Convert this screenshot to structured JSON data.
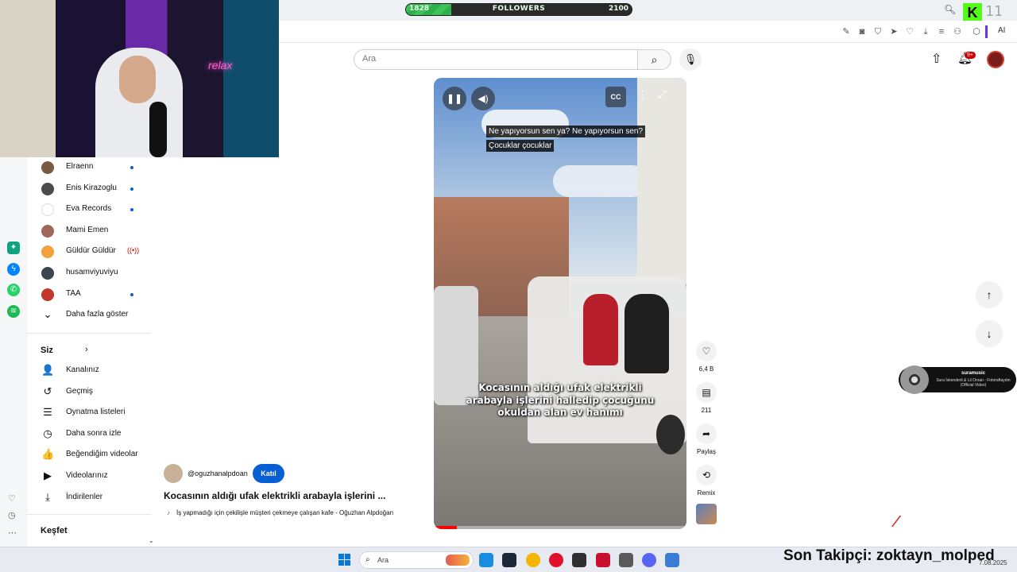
{
  "browser": {
    "followers": {
      "min": "1828",
      "label": "FOLLOWERS",
      "max": "2100",
      "progress_fraction": 0.2
    },
    "kick_logo": "K",
    "kick_digits": "11",
    "ai_label": "AI",
    "tool_icons": [
      "edit-icon",
      "camera-icon",
      "shield-icon",
      "send-icon",
      "heart-icon",
      "download-icon",
      "menu-icon",
      "extensions-icon",
      "puzzle-icon"
    ]
  },
  "webcam": {
    "neon_text": "relax"
  },
  "sidebar": {
    "subscriptions": [
      {
        "label": "Elraenn",
        "status": "dot",
        "avatar_color": "#7b5a44"
      },
      {
        "label": "Enis Kirazoglu",
        "status": "dot",
        "avatar_color": "#4b4b4b"
      },
      {
        "label": "Eva Records",
        "status": "dot",
        "avatar_color": "#ffffff"
      },
      {
        "label": "Mami Emen",
        "status": "none",
        "avatar_color": "#a0685a"
      },
      {
        "label": "Güldür Güldür",
        "status": "live",
        "avatar_color": "#f2a23c"
      },
      {
        "label": "husamviyuviyu",
        "status": "none",
        "avatar_color": "#3d4552"
      },
      {
        "label": "TAA",
        "status": "dot",
        "avatar_color": "#c0392b"
      }
    ],
    "show_more": "Daha fazla göster",
    "you_heading": "Siz",
    "you_items": [
      {
        "label": "Kanalınız",
        "icon": "user-box-icon",
        "glyph": "👤"
      },
      {
        "label": "Geçmiş",
        "icon": "history-icon",
        "glyph": "↺"
      },
      {
        "label": "Oynatma listeleri",
        "icon": "playlist-icon",
        "glyph": "☰"
      },
      {
        "label": "Daha sonra izle",
        "icon": "clock-icon",
        "glyph": "◷"
      },
      {
        "label": "Beğendiğim videolar",
        "icon": "thumb-up-icon",
        "glyph": "👍"
      },
      {
        "label": "Videolarınız",
        "icon": "video-icon",
        "glyph": "▶"
      },
      {
        "label": "İndirilenler",
        "icon": "download-icon",
        "glyph": "⤓"
      }
    ],
    "explore_heading": "Keşfet"
  },
  "header": {
    "search_placeholder": "Ara",
    "notification_count": "9+"
  },
  "video": {
    "caption_top_1": "Ne yapıyorsun sen ya? Ne yapıyorsun sen?",
    "caption_top_2": "Çocuklar çocuklar",
    "caption_bottom": "Kocasının aldığı ufak elektrikli arabayla işlerini halledip çocuğunu okuldan alan ev hanımı",
    "cc_label": "CC",
    "progress_fraction": 0.09
  },
  "actions": {
    "likes": "6,4 B",
    "comments": "211",
    "share": "Paylaş",
    "remix": "Remix"
  },
  "short": {
    "channel": "@oguzhanalpdoan",
    "join_label": "Katıl",
    "title": "Kocasının aldığı ufak elektrikli arabayla işlerini ...",
    "music": "İş yapmadığı için çekilişle müşteri çekmeye çalışan kafe - Oğuzhan Alpdoğan"
  },
  "music_widget": {
    "user": "suramusic",
    "track": "Sura İskenderli & Lil Orxan - Fotoraftaydın (Official Video)"
  },
  "taskbar": {
    "search_label": "Ara",
    "ticker": "Son Takipçi: zoktayn_molped",
    "date": "7.08.2025",
    "apps": [
      {
        "name": "edge-icon",
        "color": "#1b8de0"
      },
      {
        "name": "steam-icon",
        "color": "#1b2838"
      },
      {
        "name": "chrome-icon",
        "color": "#f4b400"
      },
      {
        "name": "opera-icon",
        "color": "#e0102a"
      },
      {
        "name": "obs-icon",
        "color": "#302e31"
      },
      {
        "name": "recorder-icon",
        "color": "#c8102e"
      },
      {
        "name": "app-icon",
        "color": "#5a5a5a"
      },
      {
        "name": "discord-icon",
        "color": "#5865f2"
      },
      {
        "name": "settings-icon",
        "color": "#3a7bd5"
      }
    ]
  }
}
